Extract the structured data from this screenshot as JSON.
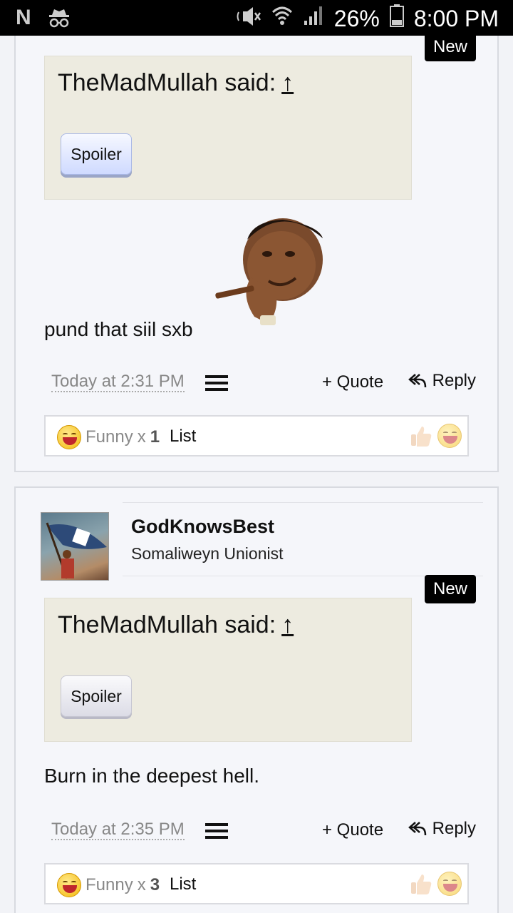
{
  "status_bar": {
    "left_icon": "N",
    "battery": "26%",
    "time": "8:00 PM"
  },
  "posts": [
    {
      "new_label": "New",
      "quote": {
        "author_said": "TheMadMullah said:",
        "arrow": "↑",
        "spoiler_label": "Spoiler"
      },
      "body": "pund that siil sxb",
      "time": "Today at 2:31 PM",
      "quote_label": "+ Quote",
      "reply_label": "Reply",
      "reactions": {
        "label": "Funny",
        "x": "x",
        "count": "1",
        "list_label": "List"
      }
    },
    {
      "username": "GodKnowsBest",
      "user_title": "Somaliweyn Unionist",
      "new_label": "New",
      "quote": {
        "author_said": "TheMadMullah said:",
        "arrow": "↑",
        "spoiler_label": "Spoiler"
      },
      "body": "Burn in the deepest hell.",
      "time": "Today at 2:35 PM",
      "quote_label": "+ Quote",
      "reply_label": "Reply",
      "reactions": {
        "label": "Funny",
        "x": "x",
        "count": "3",
        "list_label": "List"
      }
    }
  ]
}
